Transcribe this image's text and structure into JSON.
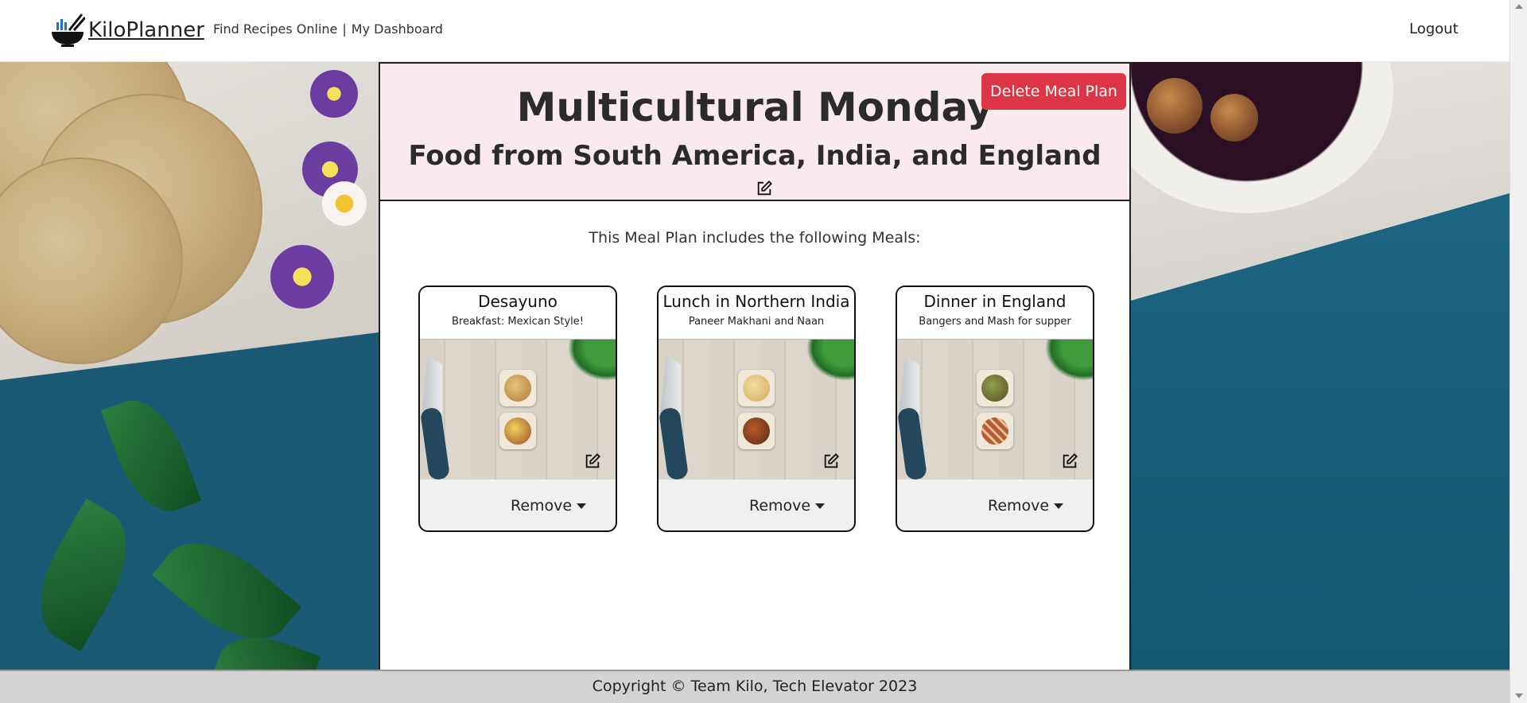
{
  "navbar": {
    "brand": "KiloPlanner",
    "links": [
      "Find Recipes Online",
      "My Dashboard"
    ],
    "separator": "|",
    "logout": "Logout"
  },
  "meal_plan": {
    "title": "Multicultural Monday",
    "subtitle": "Food from South America, India, and England",
    "delete_label": "Delete Meal Plan",
    "includes_text": "This Meal Plan includes the following Meals:"
  },
  "meals": [
    {
      "title": "Desayuno",
      "description": "Breakfast: Mexican Style!",
      "remove_label": "Remove",
      "dish_colors": [
        "#c9934b",
        "#a5592f"
      ]
    },
    {
      "title": "Lunch in Northern India",
      "description": "Paneer Makhani and Naan",
      "remove_label": "Remove",
      "dish_colors": [
        "#e3c58b",
        "#8c3d1e"
      ]
    },
    {
      "title": "Dinner in England",
      "description": "Bangers and Mash for supper",
      "remove_label": "Remove",
      "dish_colors": [
        "#7a8a4a",
        "#9c4a3a"
      ]
    }
  ],
  "footer": {
    "text": "Copyright © Team Kilo, Tech Elevator 2023"
  },
  "colors": {
    "delete_button": "#dc3545",
    "header_tint": "#f8e8ec",
    "footer_bg": "#d3d3d3"
  },
  "icons": [
    "bowl-logo-icon",
    "edit-icon",
    "caret-down-icon"
  ]
}
